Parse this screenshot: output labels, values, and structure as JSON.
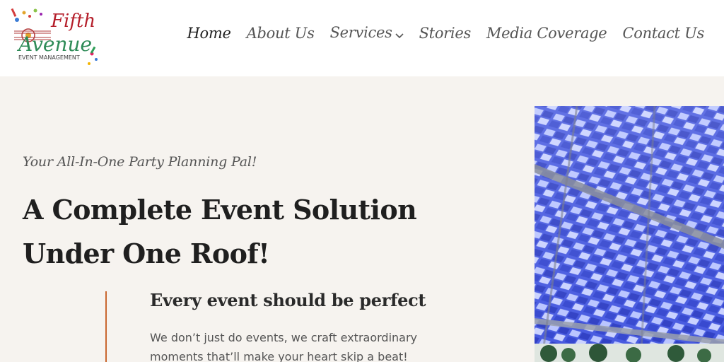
{
  "logo": {
    "line1": "Fifth",
    "line2": "Avenue",
    "sub": "EVENT MANAGEMENT"
  },
  "nav": {
    "items": [
      {
        "label": "Home",
        "active": true
      },
      {
        "label": "About Us",
        "active": false
      },
      {
        "label": "Services",
        "active": false,
        "has_dropdown": true
      },
      {
        "label": "Stories",
        "active": false
      },
      {
        "label": "Media Coverage",
        "active": false
      },
      {
        "label": "Contact Us",
        "active": false
      }
    ]
  },
  "hero": {
    "tagline": "Your All-In-One Party Planning Pal!",
    "headline_line1": "A Complete Event Solution",
    "headline_line2": "Under One Roof!",
    "subhead": "Every event should be perfect",
    "para_line1": "We don’t just do events, we craft extraordinary",
    "para_line2": "moments that’ll make your heart skip a beat!"
  },
  "colors": {
    "accent": "#c9672f",
    "background": "#f6f3ef",
    "canopy_blue": "#3d4fd4"
  }
}
